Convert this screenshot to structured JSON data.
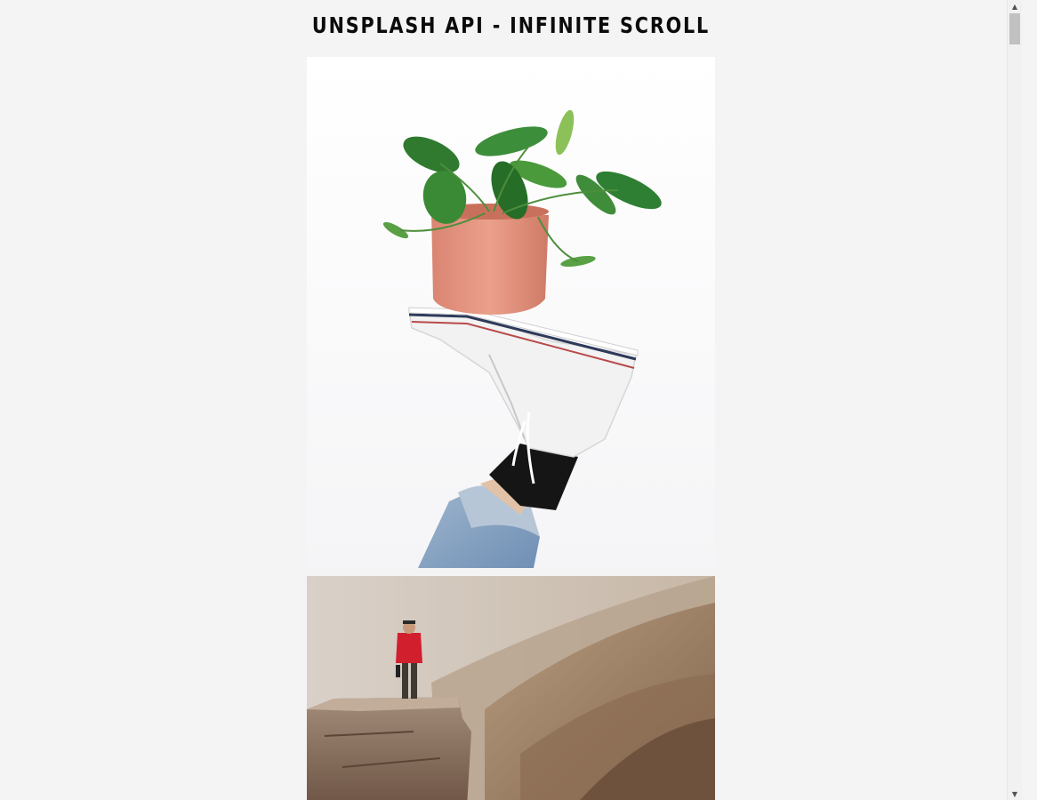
{
  "header": {
    "title": "UNSPLASH API - INFINITE SCROLL"
  },
  "images": [
    {
      "name": "photo-plant-on-sneaker",
      "alt": "Potted plant balanced on a white sneaker"
    },
    {
      "name": "photo-man-on-cliff",
      "alt": "Man in red jacket standing on a cliff edge"
    }
  ],
  "colors": {
    "background": "#f4f4f4",
    "title": "#0b0b0b"
  }
}
